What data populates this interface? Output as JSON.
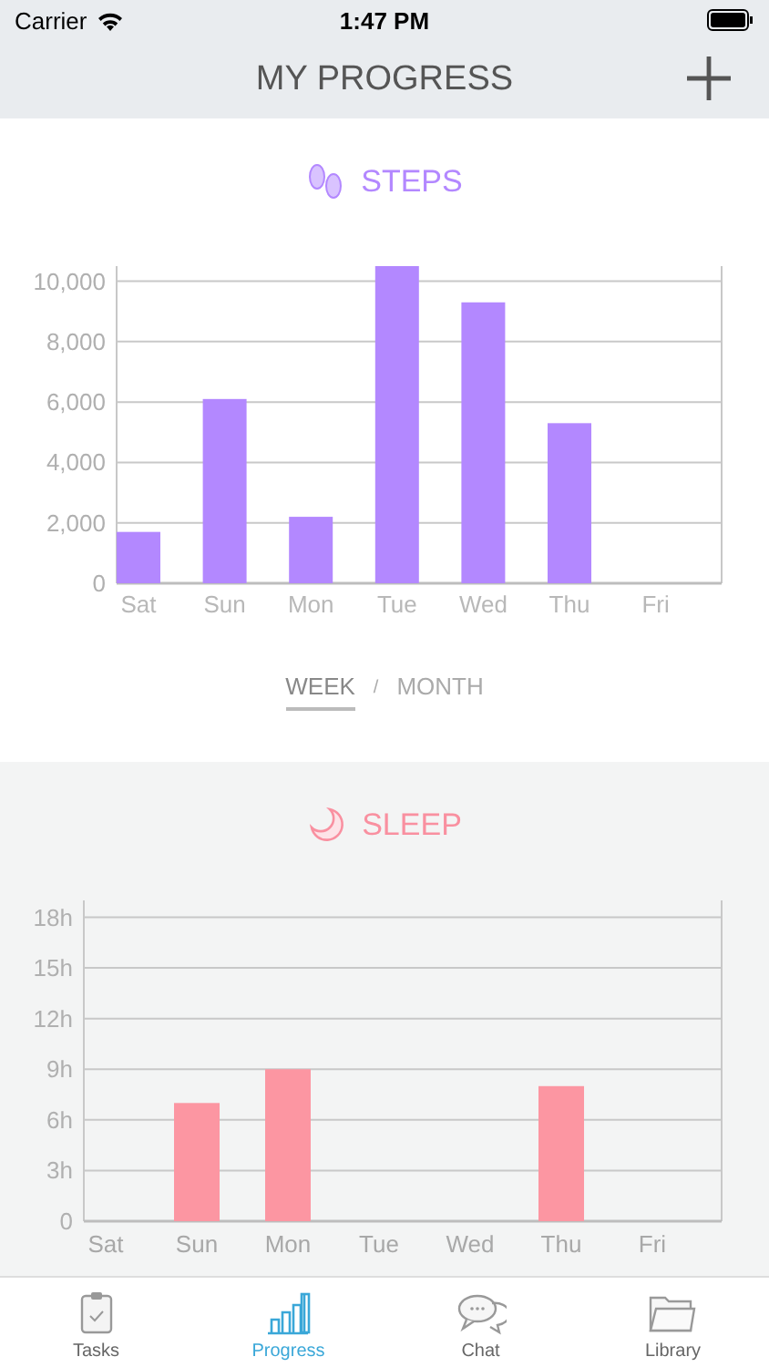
{
  "status_bar": {
    "carrier": "Carrier",
    "time": "1:47 PM"
  },
  "nav": {
    "title": "MY PROGRESS"
  },
  "sections": [
    {
      "kind": "steps",
      "title": "STEPS",
      "color": "#b388ff",
      "chart_data": {
        "type": "bar",
        "categories": [
          "Sat",
          "Sun",
          "Mon",
          "Tue",
          "Wed",
          "Thu",
          "Fri"
        ],
        "series": [
          {
            "color": "#b388ff",
            "values": [
              1700,
              6100,
              2200,
              10500,
              9300,
              5300,
              null
            ]
          }
        ],
        "ylim": [
          0,
          10500
        ],
        "grid": true,
        "yticks": [
          {
            "value": 0,
            "label": "0"
          },
          {
            "value": 2000,
            "label": "2,000"
          },
          {
            "value": 4000,
            "label": "4,000"
          },
          {
            "value": 6000,
            "label": "6,000"
          },
          {
            "value": 8000,
            "label": "8,000"
          },
          {
            "value": 10000,
            "label": "10,000"
          }
        ]
      },
      "range_toggle": [
        {
          "label": "WEEK",
          "selected": true
        },
        {
          "label": "MONTH",
          "selected": false
        }
      ],
      "separator": "/"
    },
    {
      "kind": "sleep",
      "title": "SLEEP",
      "color": "#f990a0",
      "chart_data": {
        "type": "bar",
        "categories": [
          "Sat",
          "Sun",
          "Mon",
          "Tue",
          "Wed",
          "Thu",
          "Fri"
        ],
        "series": [
          {
            "color": "#fc96a2",
            "values": [
              null,
              7,
              9,
              null,
              null,
              8,
              null
            ]
          }
        ],
        "ylim": [
          0,
          19
        ],
        "grid": true,
        "yticks": [
          {
            "value": 0,
            "label": "0"
          },
          {
            "value": 3,
            "label": "3h"
          },
          {
            "value": 6,
            "label": "6h"
          },
          {
            "value": 9,
            "label": "9h"
          },
          {
            "value": 12,
            "label": "12h"
          },
          {
            "value": 15,
            "label": "15h"
          },
          {
            "value": 18,
            "label": "18h"
          }
        ]
      }
    }
  ],
  "tab_bar": [
    {
      "kind": "tasks",
      "label": "Tasks",
      "selected": false
    },
    {
      "kind": "progress",
      "label": "Progress",
      "selected": true
    },
    {
      "kind": "chat",
      "label": "Chat",
      "selected": false
    },
    {
      "kind": "library",
      "label": "Library",
      "selected": false
    }
  ]
}
